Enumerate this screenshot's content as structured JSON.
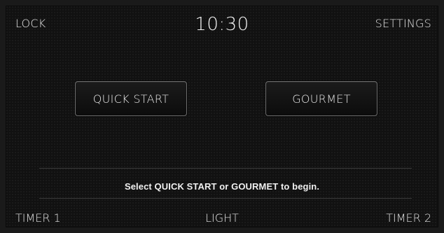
{
  "header": {
    "lock_label": "LOCK",
    "time": "10:30",
    "settings_label": "SETTINGS"
  },
  "modes": {
    "quick_start_label": "QUICK START",
    "gourmet_label": "GOURMET"
  },
  "status": {
    "message": "Select QUICK START or GOURMET to begin."
  },
  "footer": {
    "timer1_label": "TIMER 1",
    "light_label": "LIGHT",
    "timer2_label": "TIMER 2"
  },
  "colors": {
    "background": "#111111",
    "text": "#e6e6e6",
    "button_border": "#6e6e6e",
    "divider": "#3a3a3a"
  }
}
